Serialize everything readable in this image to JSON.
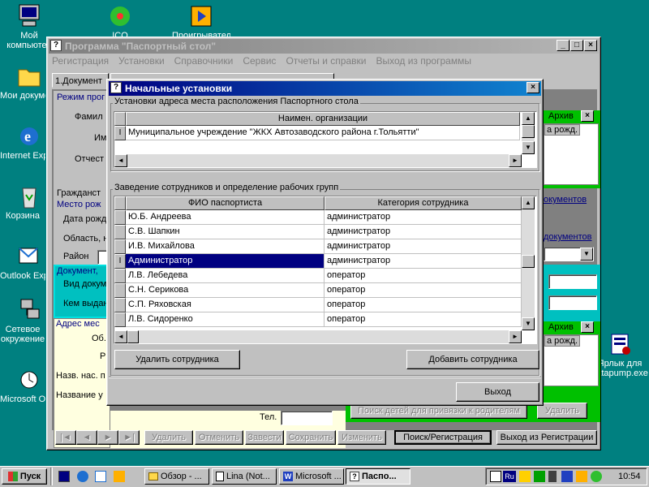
{
  "desktop": {
    "icons": [
      {
        "label": "Мой компьютер",
        "icon": "my-computer-icon"
      },
      {
        "label": "Мои документы",
        "icon": "my-documents-icon"
      },
      {
        "label": "Internet Explorer",
        "icon": "internet-explorer-icon"
      },
      {
        "label": "Корзина",
        "icon": "recycle-bin-icon"
      },
      {
        "label": "Outlook Express",
        "icon": "outlook-express-icon"
      },
      {
        "label": "Сетевое окружение",
        "icon": "network-icon"
      },
      {
        "label": "Microsoft Outlook",
        "icon": "ms-outlook-icon"
      },
      {
        "label": "ICQ",
        "icon": "icq-icon"
      },
      {
        "label": "Проигрыватель",
        "icon": "media-player-icon"
      },
      {
        "label": "Ярлык для datapump.exe",
        "icon": "datapump-shortcut-icon"
      }
    ]
  },
  "main_window": {
    "title": "Программа \"Паспортный стол\"",
    "menu": [
      "Регистрация",
      "Установки",
      "Справочники",
      "Сервис",
      "Отчеты и справки",
      "Выход из программы"
    ],
    "tab_label": "1.Документ",
    "left_labels": {
      "mode": "Режим прог",
      "surname": "Фамил",
      "name": "Им",
      "patronymic": "Отчест",
      "citizenship": "Гражданст",
      "birthplace": "Место рож",
      "birthdate": "Дата рожд",
      "region": "Область, н",
      "district": "Район",
      "document": "Документ,",
      "doc_type": "Вид докум",
      "issued_by": "Кем выдан",
      "address": "Адрес мес",
      "ob": "Об.",
      "r": "Р",
      "org_name_short": "Назв. нас. п",
      "org_name": "Название у"
    },
    "right_panels": {
      "archive": "Архив",
      "birth": "а рожд.",
      "documents": "окументов",
      "documents2": "документов",
      "archive2": "Архив",
      "birth2": "а рожд.",
      "phone_label": "Тел.",
      "search_children": "Поиск детей для привязки к родителям",
      "delete": "Удалить"
    },
    "toolbar": {
      "first": "|◄",
      "prev": "◄",
      "next": "►",
      "last": "►|",
      "delete": "Удалить",
      "cancel": "Отменить",
      "create": "Завести",
      "save": "Сохранить",
      "change": "Изменить",
      "search_reg": "Поиск/Регистрация",
      "exit_reg": "Выход из Регистрации"
    }
  },
  "dialog": {
    "title": "Начальные установки",
    "address_group": "Установки адреса места расположения Паспортного стола",
    "org_header": "Наимен. организации",
    "org_value": "Муниципальное учреждение  \"ЖКХ Автозаводского района г.Тольятти\"",
    "staff_group": "Заведение сотрудников и определение рабочих групп",
    "columns": [
      "ФИО паспортиста",
      "Категория сотрудника"
    ],
    "rows": [
      {
        "name": "Ю.Б. Андреева",
        "category": "администратор"
      },
      {
        "name": "С.В. Шапкин",
        "category": "администратор"
      },
      {
        "name": "И.В. Михайлова",
        "category": "администратор"
      },
      {
        "name": "Администратор",
        "category": "администратор"
      },
      {
        "name": "Л.В. Лебедева",
        "category": "оператор"
      },
      {
        "name": "С.Н. Серикова",
        "category": "оператор"
      },
      {
        "name": "С.П. Ряховская",
        "category": "оператор"
      },
      {
        "name": "Л.В. Сидоренко",
        "category": "оператор"
      }
    ],
    "selected_row": 3,
    "delete_button": "Удалить сотрудника",
    "add_button": "Добавить сотрудника",
    "exit_button": "Выход"
  },
  "taskbar": {
    "start": "Пуск",
    "tasks": [
      "Обзор - ...",
      "Lina (Not...",
      "Microsoft ...",
      "Паспо..."
    ],
    "active_task": 3,
    "clock": "10:54",
    "lang": "Ru"
  },
  "colors": {
    "desktop": "#008080",
    "title_active": "#000080",
    "selection": "#000080",
    "panel_cyan": "#00c0c0",
    "panel_yellow": "#ffffe0",
    "archive_green": "#00c000"
  }
}
